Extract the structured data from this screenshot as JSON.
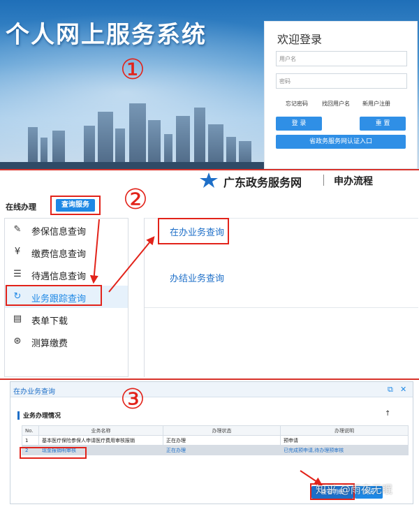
{
  "panel1": {
    "banner_title": "个人网上服务系统",
    "step_marker": "①",
    "login": {
      "heading": "欢迎登录",
      "username_placeholder": "用户名",
      "password_placeholder": "密码",
      "forgot_password": "忘记密码",
      "retrieve_username": "找回用户名",
      "register": "新用户注册",
      "login_button": "登 录",
      "reset_button": "重 置",
      "gov_auth_button": "省政务服务网认证入口"
    }
  },
  "panel2": {
    "site_title": "广东政务服务网",
    "site_subtitle": "申办流程",
    "step_marker": "②",
    "online_label": "在线办理",
    "query_service": "查询服务",
    "menu": [
      {
        "label": "参保信息查询",
        "icon": "document-edit-icon"
      },
      {
        "label": "缴费信息查询",
        "icon": "coin-icon"
      },
      {
        "label": "待遇信息查询",
        "icon": "document-list-icon"
      },
      {
        "label": "业务跟踪查询",
        "icon": "track-icon"
      },
      {
        "label": "表单下载",
        "icon": "form-icon"
      },
      {
        "label": "测算缴费",
        "icon": "calculator-icon"
      }
    ],
    "active_menu_index": 3,
    "links": {
      "in_progress": "在办业务查询",
      "completed": "办结业务查询"
    }
  },
  "panel3": {
    "step_marker": "③",
    "window_title": "在办业务查询",
    "section_title": "业务办理情况",
    "table": {
      "headers": [
        "No.",
        "业务名称",
        "办理状态",
        "办理说明"
      ],
      "rows": [
        [
          "1",
          "基本医疗保险参保人申请医疗费用审核报销",
          "正在办理",
          "预申请"
        ],
        [
          "2",
          "现金报销明审核",
          "正在办理",
          "已完成预申请,待办理预审核"
        ]
      ],
      "selected_row": 1
    },
    "view_details_button": "查看明细",
    "back_button": "关闭",
    "watermark": "知乎 @雨夜无眠"
  },
  "colors": {
    "accent": "#1e88e5",
    "annotation_red": "#e2231a",
    "link_blue": "#1e6fc8"
  }
}
